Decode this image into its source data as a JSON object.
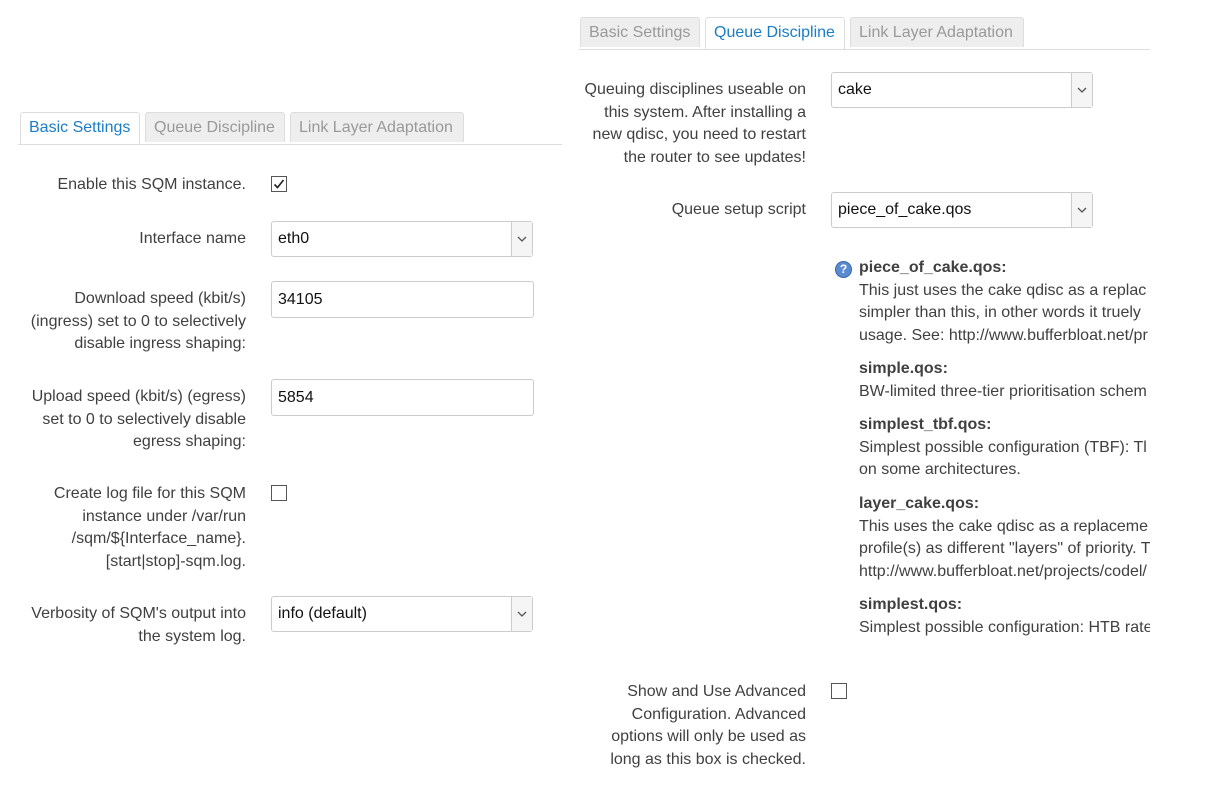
{
  "left_panel": {
    "tabs": [
      {
        "label": "Basic Settings",
        "active": true
      },
      {
        "label": "Queue Discipline",
        "active": false
      },
      {
        "label": "Link Layer Adaptation",
        "active": false
      }
    ],
    "fields": {
      "enable": {
        "label": "Enable this SQM instance.",
        "checked": true
      },
      "interface": {
        "label": "Interface name",
        "value": "eth0"
      },
      "download": {
        "label_lines": [
          "Download speed (kbit/s)",
          "(ingress) set to 0 to selectively",
          "disable ingress shaping:"
        ],
        "value": "34105"
      },
      "upload": {
        "label_lines": [
          "Upload speed (kbit/s) (egress)",
          "set to 0 to selectively disable",
          "egress shaping:"
        ],
        "value": "5854"
      },
      "log": {
        "label_lines": [
          "Create log file for this SQM",
          "instance under /var/run",
          "/sqm/${Interface_name}.",
          "[start|stop]-sqm.log."
        ],
        "checked": false
      },
      "verbosity": {
        "label_lines": [
          "Verbosity of SQM's output into",
          "the system log."
        ],
        "value": "info (default)"
      }
    }
  },
  "right_panel": {
    "tabs": [
      {
        "label": "Basic Settings",
        "active": false
      },
      {
        "label": "Queue Discipline",
        "active": true
      },
      {
        "label": "Link Layer Adaptation",
        "active": false
      }
    ],
    "qdisc": {
      "label_lines": [
        "Queuing disciplines useable on",
        "this system. After installing a",
        "new qdisc, you need to restart",
        "the router to see updates!"
      ],
      "value": "cake"
    },
    "script": {
      "label": "Queue setup script",
      "value": "piece_of_cake.qos"
    },
    "help_icon": "question-icon",
    "help": [
      {
        "title": "piece_of_cake.qos:",
        "lines": [
          "This just uses the cake qdisc as a replac",
          "simpler than this, in other words it truely",
          "usage. See: http://www.bufferbloat.net/pr"
        ]
      },
      {
        "title": "simple.qos:",
        "lines": [
          "BW-limited three-tier prioritisation schem"
        ]
      },
      {
        "title": "simplest_tbf.qos:",
        "lines": [
          "Simplest possible configuration (TBF): Tl",
          "on some architectures."
        ]
      },
      {
        "title": "layer_cake.qos:",
        "lines": [
          "This uses the cake qdisc as a replaceme",
          "profile(s) as different \"layers\" of priority. T",
          "http://www.bufferbloat.net/projects/codel/"
        ]
      },
      {
        "title": "simplest.qos:",
        "lines": [
          "Simplest possible configuration: HTB rate"
        ]
      }
    ],
    "advanced": {
      "label_lines": [
        "Show and Use Advanced",
        "Configuration. Advanced",
        "options will only be used as",
        "long as this box is checked."
      ],
      "checked": false
    }
  },
  "colors": {
    "accent": "#1b7dc4",
    "tab_inactive": "#999999",
    "label": "#404040"
  }
}
